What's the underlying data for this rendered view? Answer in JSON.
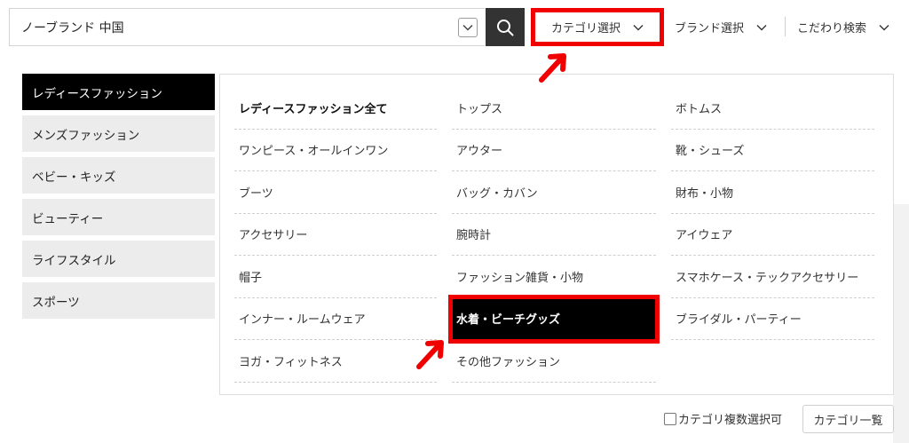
{
  "search": {
    "value": "ノーブランド 中国"
  },
  "nav": {
    "category_label": "カテゴリ選択",
    "brand_label": "ブランド選択",
    "kodawari_label": "こだわり検索"
  },
  "sidebar": {
    "items": [
      {
        "label": "レディースファッション",
        "active": true
      },
      {
        "label": "メンズファッション"
      },
      {
        "label": "ベビー・キッズ"
      },
      {
        "label": "ビューティー"
      },
      {
        "label": "ライフスタイル"
      },
      {
        "label": "スポーツ"
      }
    ]
  },
  "categories": {
    "rows": [
      [
        "レディースファッション全て",
        "トップス",
        "ボトムス"
      ],
      [
        "ワンピース・オールインワン",
        "アウター",
        "靴・シューズ"
      ],
      [
        "ブーツ",
        "バッグ・カバン",
        "財布・小物"
      ],
      [
        "アクセサリー",
        "腕時計",
        "アイウェア"
      ],
      [
        "帽子",
        "ファッション雑貨・小物",
        "スマホケース・テックアクセサリー"
      ],
      [
        "インナー・ルームウェア",
        "水着・ビーチグッズ",
        "ブライダル・パーティー"
      ],
      [
        "ヨガ・フィットネス",
        "その他ファッション",
        ""
      ]
    ],
    "highlighted": "水着・ビーチグッズ"
  },
  "footer": {
    "multi_select_label": "カテゴリ複数選択可",
    "list_button_label": "カテゴリ一覧"
  },
  "colors": {
    "annotation": "#f00000",
    "active_bg": "#000000"
  }
}
